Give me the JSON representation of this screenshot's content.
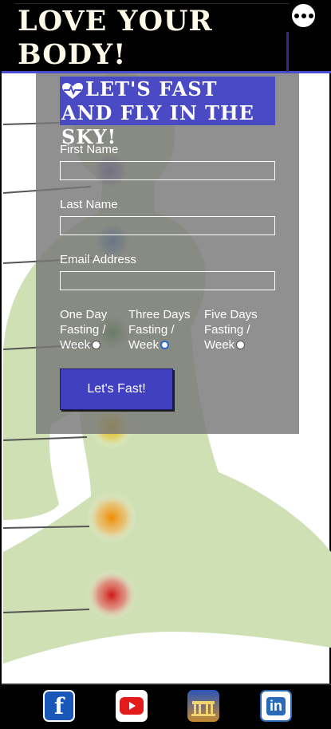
{
  "header": {
    "title": "LOVE YOUR BODY!"
  },
  "form": {
    "title": "LET'S FAST AND FLY IN THE SKY!",
    "first_name_label": "First Name",
    "last_name_label": "Last Name",
    "email_label": "Email Address",
    "options": [
      {
        "line1": "One Day",
        "line2": "Fasting /",
        "line3": "Week",
        "selected": false
      },
      {
        "line1": "Three Days",
        "line2": "Fasting /",
        "line3": "Week",
        "selected": true
      },
      {
        "line1": "Five Days",
        "line2": "Fasting /",
        "line3": "Week",
        "selected": false
      }
    ],
    "submit_label": "Let's Fast!"
  },
  "footer": {
    "icons": [
      "facebook-icon",
      "youtube-icon",
      "gallery-icon",
      "linkedin-icon"
    ],
    "facebook_text": "f",
    "linkedin_text": "in"
  },
  "colors": {
    "accent": "#4a4ac4",
    "button": "#4040c0"
  }
}
